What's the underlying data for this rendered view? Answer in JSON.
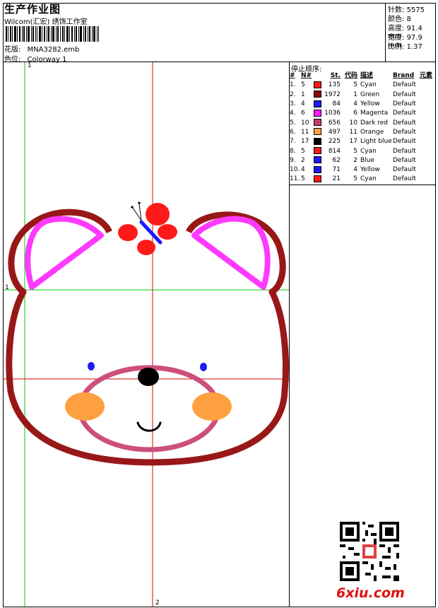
{
  "header": {
    "title": "生产作业图",
    "studio": "Wilcom(汇宏) 绣饰工作室",
    "design_label": "花版:",
    "design_value": "MNA3282.emb",
    "colorway_label": "色位:",
    "colorway_value": "Colorway 1"
  },
  "stats": [
    {
      "label": "针数:",
      "value": "5575"
    },
    {
      "label": "颜色:",
      "value": "8"
    },
    {
      "label": "高度:",
      "value": "91.4 mm"
    },
    {
      "label": "宽度:",
      "value": "97.9 mm"
    },
    {
      "label": "比例:",
      "value": "1.37"
    }
  ],
  "stop_sequence": {
    "title": "停止顺序:",
    "headers": [
      "#",
      "N#",
      "St.",
      "代码",
      "描述",
      "Brand",
      "元素"
    ],
    "rows": [
      {
        "idx": "1.",
        "n": "5",
        "color": "#ff1a1a",
        "st": "135",
        "code": "5",
        "desc": "Cyan",
        "brand": "Default"
      },
      {
        "idx": "2.",
        "n": "1",
        "color": "#8b0a0a",
        "st": "1972",
        "code": "1",
        "desc": "Green",
        "brand": "Default"
      },
      {
        "idx": "3.",
        "n": "4",
        "color": "#1a1aff",
        "st": "84",
        "code": "4",
        "desc": "Yellow",
        "brand": "Default"
      },
      {
        "idx": "4.",
        "n": "6",
        "color": "#ff1aff",
        "st": "1036",
        "code": "6",
        "desc": "Magenta",
        "brand": "Default"
      },
      {
        "idx": "5.",
        "n": "10",
        "color": "#c43c6e",
        "st": "656",
        "code": "10",
        "desc": "Dark red",
        "brand": "Default"
      },
      {
        "idx": "6.",
        "n": "11",
        "color": "#ffa040",
        "st": "497",
        "code": "11",
        "desc": "Orange",
        "brand": "Default"
      },
      {
        "idx": "7.",
        "n": "17",
        "color": "#000000",
        "st": "225",
        "code": "17",
        "desc": "Light blue",
        "brand": "Default"
      },
      {
        "idx": "8.",
        "n": "5",
        "color": "#ff1a1a",
        "st": "814",
        "code": "5",
        "desc": "Cyan",
        "brand": "Default"
      },
      {
        "idx": "9.",
        "n": "2",
        "color": "#1a1aff",
        "st": "62",
        "code": "2",
        "desc": "Blue",
        "brand": "Default"
      },
      {
        "idx": "10.",
        "n": "4",
        "color": "#1a1aff",
        "st": "71",
        "code": "4",
        "desc": "Yellow",
        "brand": "Default"
      },
      {
        "idx": "11.",
        "n": "5",
        "color": "#ff1a1a",
        "st": "21",
        "code": "5",
        "desc": "Cyan",
        "brand": "Default"
      }
    ]
  },
  "guides": {
    "top_label": "1",
    "left_label": "1",
    "bottom_label": "2"
  },
  "watermark": {
    "brand": "6xiu.com"
  },
  "colors": {
    "brown": "#8b0a0a",
    "magenta": "#ff1aff",
    "red": "#ff1a1a",
    "blue": "#1a1aff",
    "pink": "#c43c6e",
    "orange": "#ffa040",
    "guide_green": "#00cc00",
    "guide_red": "#dd0000"
  }
}
